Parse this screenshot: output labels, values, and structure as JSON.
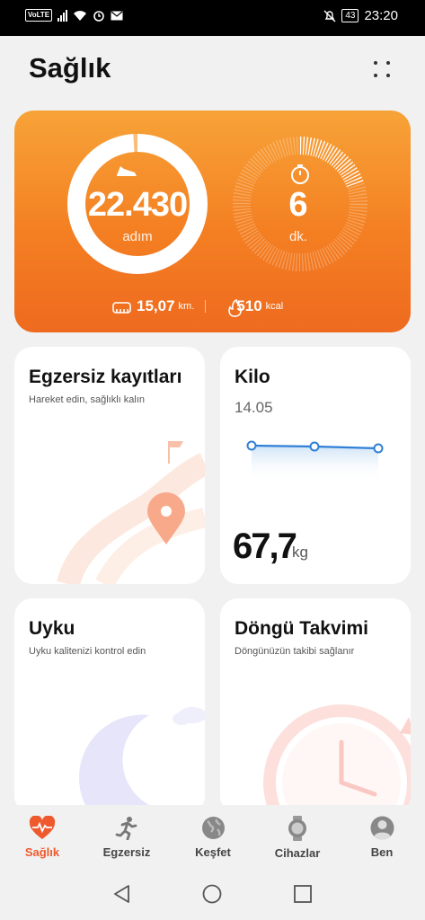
{
  "status_bar": {
    "volte": "VoLTE",
    "battery": "43",
    "time": "23:20"
  },
  "header": {
    "title": "Sağlık"
  },
  "activity": {
    "steps_value": "22.430",
    "steps_unit": "adım",
    "steps_progress": 0.99,
    "minutes_value": "6",
    "minutes_unit": "dk.",
    "minutes_progress": 0.2,
    "distance_value": "15,07",
    "distance_unit": "km.",
    "calories_value": "510",
    "calories_unit": "kcal",
    "accent": "#f47f22"
  },
  "cards": {
    "exercise": {
      "title": "Egzersiz kayıtları",
      "subtitle": "Hareket edin, sağlıklı kalın"
    },
    "weight": {
      "title": "Kilo",
      "date": "14.05",
      "value": "67,7",
      "unit": "kg",
      "line_color": "#2f7fd6"
    },
    "sleep": {
      "title": "Uyku",
      "subtitle": "Uyku kalitenizi kontrol edin"
    },
    "cycle": {
      "title": "Döngü Takvimi",
      "subtitle": "Döngünüzün takibi sağlanır"
    }
  },
  "bottom_nav": {
    "items": [
      {
        "label": "Sağlık",
        "icon": "heart-pulse-icon",
        "active": true
      },
      {
        "label": "Egzersiz",
        "icon": "runner-icon",
        "active": false
      },
      {
        "label": "Keşfet",
        "icon": "globe-icon",
        "active": false
      },
      {
        "label": "Cihazlar",
        "icon": "watch-icon",
        "active": false
      },
      {
        "label": "Ben",
        "icon": "profile-icon",
        "active": false
      }
    ],
    "active_color": "#ee5a2d"
  },
  "system_nav": {
    "back": "back-icon",
    "home": "home-icon",
    "recents": "recents-icon"
  }
}
